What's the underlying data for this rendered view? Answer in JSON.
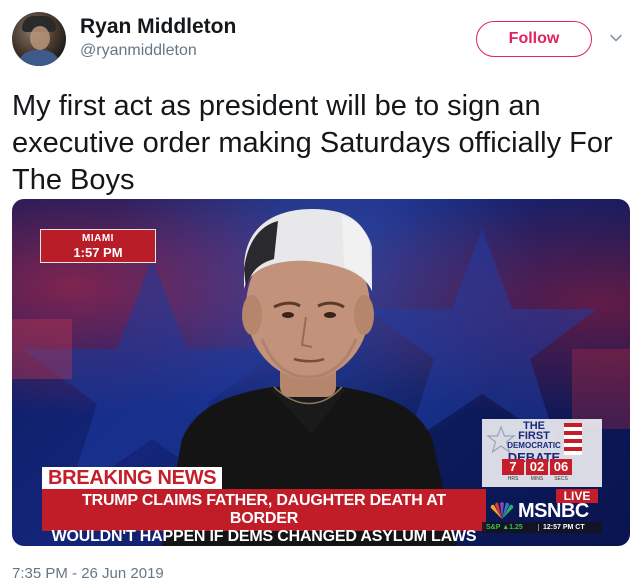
{
  "user": {
    "display_name": "Ryan Middleton",
    "handle": "@ryanmiddleton",
    "avatar_icon": "profile-photo"
  },
  "actions": {
    "follow_label": "Follow",
    "menu_icon": "chevron-down-icon"
  },
  "tweet": {
    "text": "My first act as president will be to sign an executive order making Saturdays officially For The Boys",
    "timestamp": "7:35 PM - 26 Jun 2019"
  },
  "media": {
    "location": "MIAMI",
    "local_time": "1:57 PM",
    "breaking_label": "BREAKING NEWS",
    "headline_line1": "TRUMP CLAIMS FATHER, DAUGHTER DEATH AT BORDER",
    "headline_line2": "WOULDN'T HAPPEN IF DEMS CHANGED ASYLUM LAWS",
    "debate_badge": {
      "line1": "THE FIRST",
      "line2": "DEMOCRATIC",
      "line3": "DEBATE",
      "countdown": [
        "7",
        "02",
        "06"
      ],
      "countdown_labels": [
        "HRS",
        "MINS",
        "SECS"
      ]
    },
    "live_label": "LIVE",
    "network": "MSNBC",
    "ticker_index": "S&P ▲1.25",
    "ticker_time": "12:57 PM CT"
  },
  "colors": {
    "follow_accent": "#e0245e",
    "secondary_text": "#657786",
    "breaking_red": "#c01d29"
  }
}
